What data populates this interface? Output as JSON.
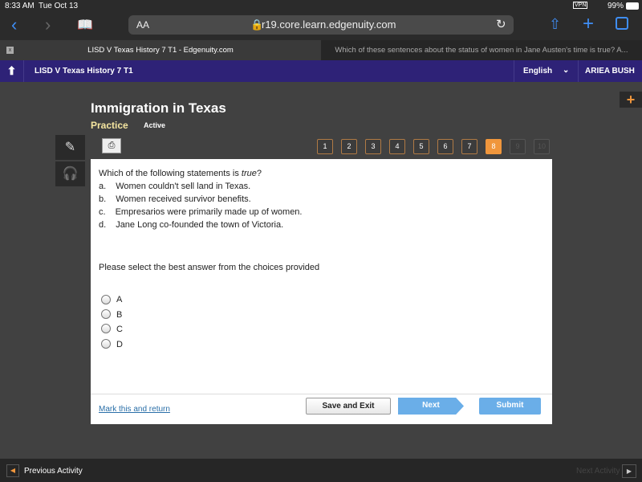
{
  "status": {
    "time": "8:33 AM",
    "date": "Tue Oct 13",
    "battery": "99%",
    "vpn": "VPN"
  },
  "browser": {
    "text_size": "AA",
    "url": "r19.core.learn.edgenuity.com",
    "tabs": [
      {
        "title": "LISD V Texas History 7 T1 - Edgenuity.com",
        "active": true
      },
      {
        "title": "Which of these sentences about the status of women in Jane Austen's time is true? A...",
        "active": false
      }
    ],
    "tab_close": "x"
  },
  "nav": {
    "course": "LISD V Texas History 7 T1",
    "language": "English",
    "user": "ARIEA BUSH"
  },
  "lesson": {
    "title": "Immigration in Texas",
    "mode": "Practice",
    "status": "Active"
  },
  "pages": [
    {
      "n": "1"
    },
    {
      "n": "2"
    },
    {
      "n": "3"
    },
    {
      "n": "4"
    },
    {
      "n": "5"
    },
    {
      "n": "6"
    },
    {
      "n": "7"
    },
    {
      "n": "8",
      "current": true
    },
    {
      "n": "9",
      "disabled": true
    },
    {
      "n": "10",
      "disabled": true
    }
  ],
  "question": {
    "prompt_pre": "Which of the following statements is ",
    "prompt_em": "true",
    "prompt_post": "?",
    "choices": [
      {
        "letter": "a.",
        "text": "Women couldn't sell land in Texas."
      },
      {
        "letter": "b.",
        "text": "Women received survivor benefits."
      },
      {
        "letter": "c.",
        "text": "Empresarios were primarily made up of women."
      },
      {
        "letter": "d.",
        "text": "Jane Long co-founded the town of Victoria."
      }
    ],
    "instruction": "Please select the best answer from the choices provided",
    "options": [
      "A",
      "B",
      "C",
      "D"
    ]
  },
  "actions": {
    "mark": "Mark this and return",
    "save": "Save and Exit",
    "next": "Next",
    "submit": "Submit"
  },
  "footer": {
    "prev": "Previous Activity",
    "next": "Next Activity"
  },
  "colors": {
    "nav": "#2e2277",
    "accent": "#f0963c",
    "button": "#6aaee8"
  }
}
